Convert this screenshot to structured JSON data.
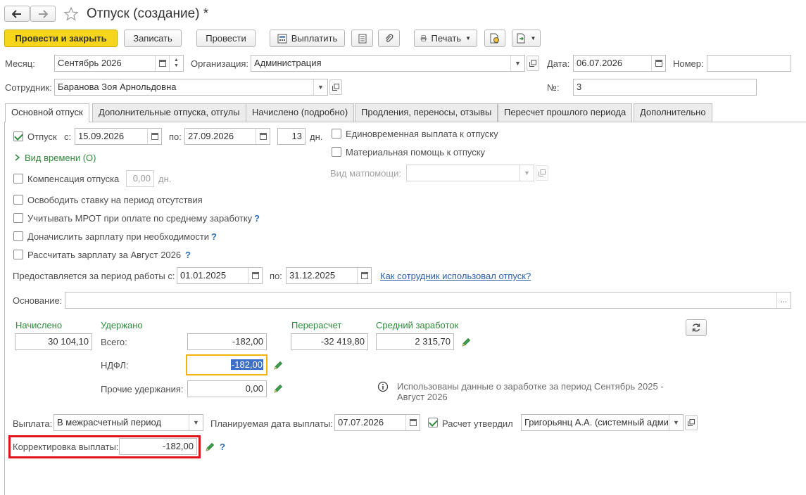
{
  "window": {
    "title": "Отпуск (создание) *"
  },
  "toolbar": {
    "post_close": "Провести и закрыть",
    "save": "Записать",
    "post": "Провести",
    "pay": "Выплатить",
    "print": "Печать"
  },
  "header": {
    "month_label": "Месяц:",
    "month_value": "Сентябрь 2026",
    "org_label": "Организация:",
    "org_value": "Администрация",
    "date_label": "Дата:",
    "date_value": "06.07.2026",
    "number_label": "Номер:",
    "number_value": "",
    "employee_label": "Сотрудник:",
    "employee_value": "Баранова Зоя Арнольдовна",
    "no_label": "№:",
    "no_value": "3"
  },
  "tabs": [
    {
      "label": "Основной отпуск"
    },
    {
      "label": "Дополнительные отпуска, отгулы"
    },
    {
      "label": "Начислено (подробно)"
    },
    {
      "label": "Продления, переносы, отзывы"
    },
    {
      "label": "Пересчет прошлого периода"
    },
    {
      "label": "Дополнительно"
    }
  ],
  "main": {
    "vacation_label": "Отпуск",
    "from_label": "с:",
    "from_value": "15.09.2026",
    "to_label": "по:",
    "to_value": "27.09.2026",
    "days_value": "13",
    "days_unit": "дн.",
    "time_kind_link": "Вид времени (О)",
    "compensation_label": "Компенсация отпуска",
    "compensation_value": "0,00",
    "compensation_unit": "дн.",
    "release_rate_label": "Освободить ставку на период отсутствия",
    "mrot_label": "Учитывать МРОТ при оплате по среднему заработку",
    "accrue_label": "Доначислить зарплату при необходимости",
    "calc_salary_label": "Рассчитать зарплату за Август 2026",
    "lump_sum_label": "Единовременная выплата к отпуску",
    "material_aid_label": "Материальная помощь к отпуску",
    "material_aid_kind_label": "Вид матпомощи:",
    "material_aid_kind_value": "",
    "period_label": "Предоставляется за период работы с:",
    "period_from": "01.01.2025",
    "period_to_label": "по:",
    "period_to": "31.12.2025",
    "usage_link": "Как сотрудник использовал отпуск?",
    "basis_label": "Основание:",
    "basis_value": "",
    "accrued_header": "Начислено",
    "accrued_value": "30 104,10",
    "withheld_header": "Удержано",
    "total_label": "Всего:",
    "total_value": "-182,00",
    "ndfl_label": "НДФЛ:",
    "ndfl_value": "-182,00",
    "other_label": "Прочие удержания:",
    "other_value": "0,00",
    "recalc_header": "Перерасчет",
    "recalc_value": "-32 419,80",
    "avg_header": "Средний заработок",
    "avg_value": "2 315,70",
    "info_text": "Использованы данные о заработке за период Сентябрь 2025 - Август 2026",
    "payment_label": "Выплата:",
    "payment_value": "В межрасчетный период",
    "planned_date_label": "Планируемая дата выплаты:",
    "planned_date_value": "07.07.2026",
    "approved_label": "Расчет утвердил",
    "approved_value": "Григорьянц А.А. (системный адми",
    "correction_label": "Корректировка выплаты:",
    "correction_value": "-182,00"
  },
  "colors": {
    "primary_button": "#f7d51a",
    "accent_green": "#2e8b3c",
    "link": "#2a5ea8",
    "highlight_border": "#e0121b",
    "focus_border": "#f0b400"
  }
}
